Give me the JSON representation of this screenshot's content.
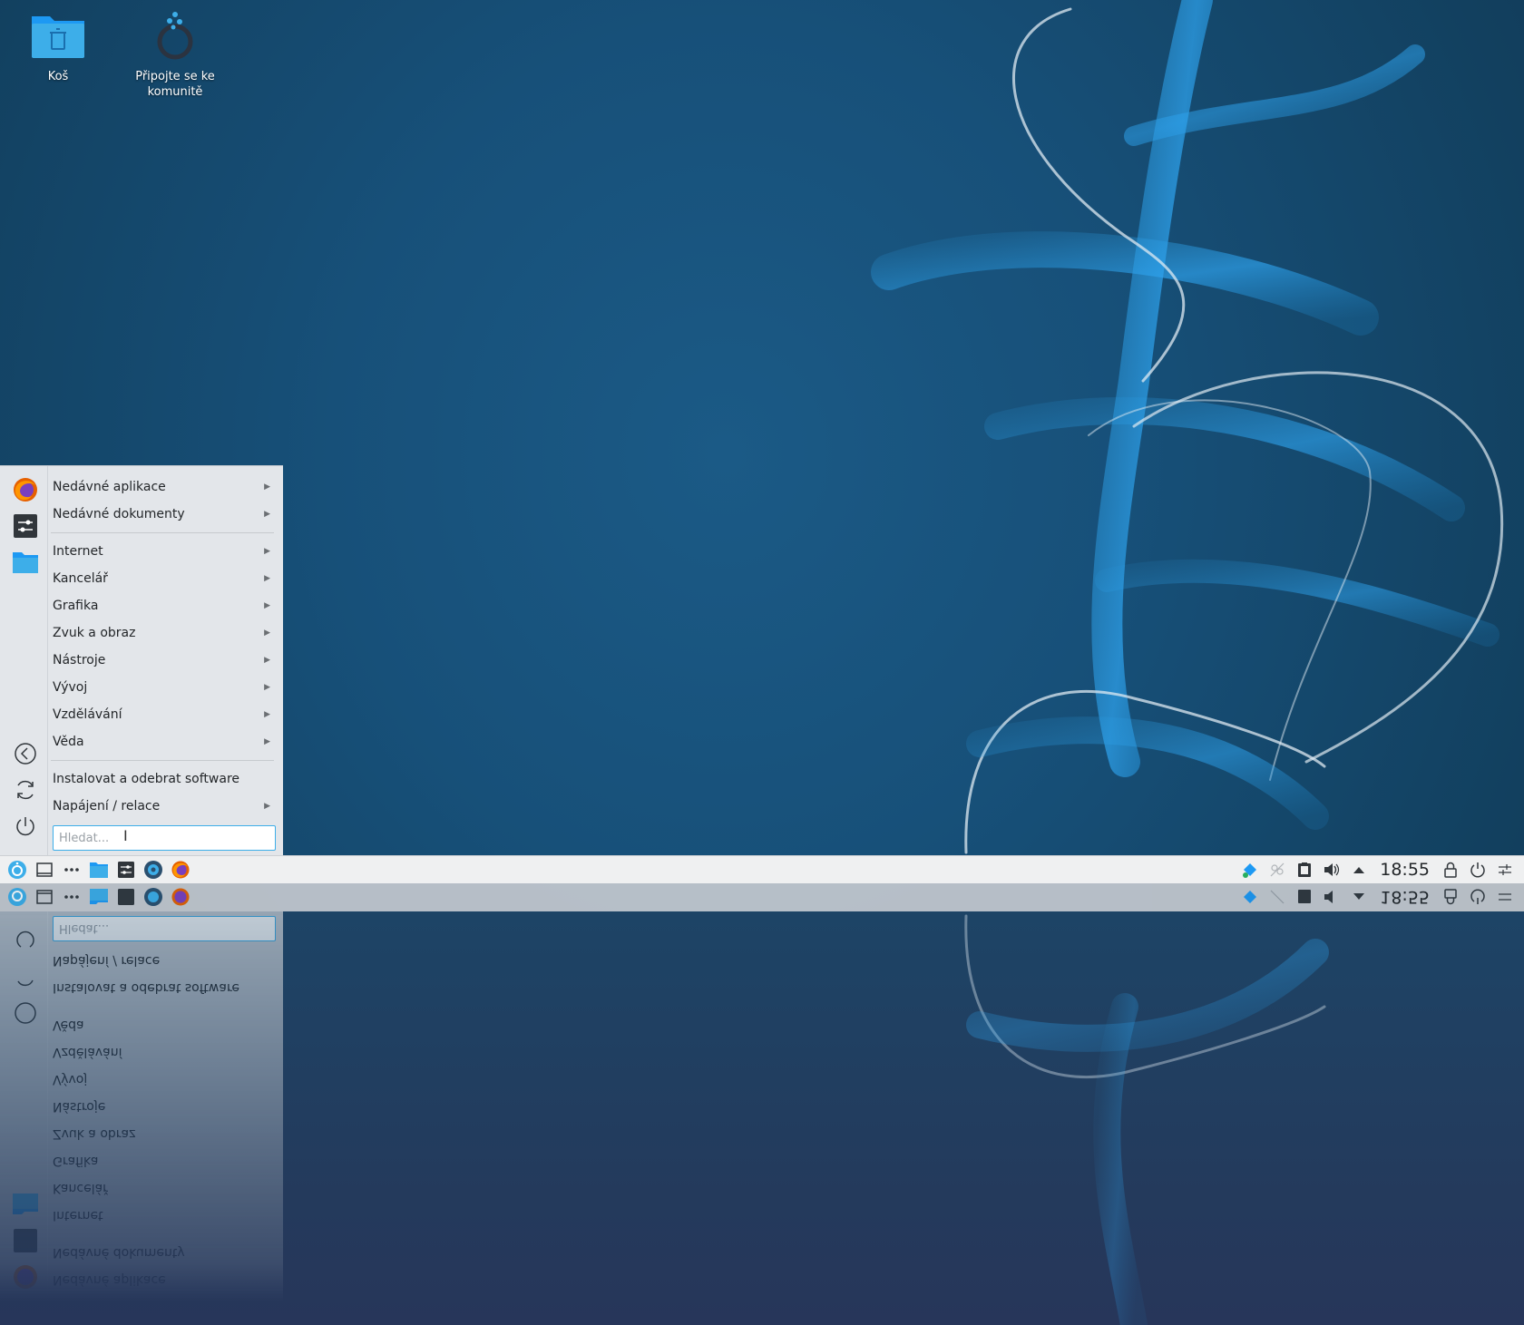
{
  "desktop": {
    "icons": [
      {
        "label": "Koš"
      },
      {
        "label": "Připojte se ke komunitě"
      }
    ]
  },
  "menu": {
    "items": [
      {
        "label": "Nedávné aplikace",
        "has_submenu": true
      },
      {
        "label": "Nedávné dokumenty",
        "has_submenu": true
      },
      {
        "label": "Internet",
        "has_submenu": true
      },
      {
        "label": "Kancelář",
        "has_submenu": true
      },
      {
        "label": "Grafika",
        "has_submenu": true
      },
      {
        "label": "Zvuk a obraz",
        "has_submenu": true
      },
      {
        "label": "Nástroje",
        "has_submenu": true
      },
      {
        "label": "Vývoj",
        "has_submenu": true
      },
      {
        "label": "Vzdělávání",
        "has_submenu": true
      },
      {
        "label": "Věda",
        "has_submenu": true
      },
      {
        "label": "Instalovat a odebrat software",
        "has_submenu": false
      },
      {
        "label": "Napájení / relace",
        "has_submenu": true
      }
    ],
    "search_placeholder": "Hledat...",
    "favorites": [
      "firefox-icon",
      "settings-icon",
      "folder-icon"
    ],
    "session_actions": [
      "back-icon",
      "refresh-icon",
      "power-icon"
    ]
  },
  "taskbar": {
    "launchers": [
      "kde-menu-icon",
      "show-desktop-icon",
      "more-icon",
      "dolphin-icon",
      "system-settings-icon",
      "discover-icon",
      "firefox-icon"
    ],
    "tray": [
      "update-icon",
      "network-icon",
      "clipboard-icon",
      "volume-icon",
      "tray-expand-icon"
    ],
    "clock": "18:55",
    "actions": [
      "lock-icon",
      "shutdown-icon",
      "panel-settings-icon"
    ]
  },
  "colors": {
    "accent": "#3daee9",
    "desktop_bg": "#17466a",
    "panel_bg": "#eff0f1",
    "menu_bg": "#e3e6ea"
  }
}
